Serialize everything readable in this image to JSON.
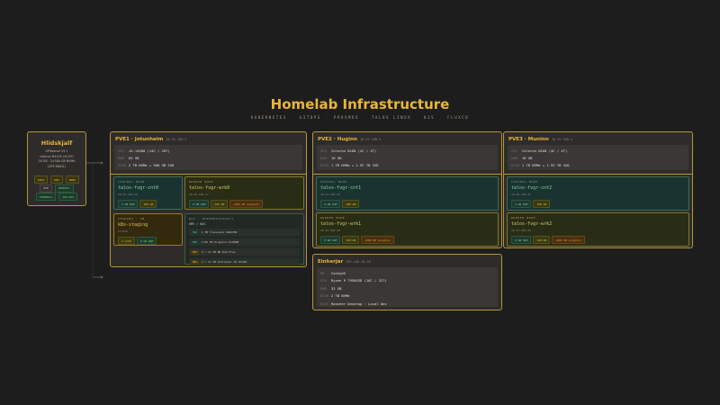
{
  "title": "Homelab Infrastructure",
  "subtitle": [
    "KUBERNETES",
    "GITOPS",
    "PROXMOX",
    "TALOS LINUX",
    "K3S",
    "FLUXCD"
  ],
  "colors": {
    "accent": "#e8b53a",
    "background": "#1e1d1d",
    "control": "#1b3330",
    "worker": "#2a2d16",
    "ram": "#7ccf99",
    "disk": "#cdc04a",
    "longhorn": "#e59a3a"
  },
  "router": {
    "name": "Hlidskjalf",
    "lines": [
      "OPNsense 25.1",
      "Celeron N5105 (4C/4T)",
      "16 GB  ·  2×500 GB NVMe",
      "(ZFS RAID1)"
    ],
    "services": [
      [
        {
          "label": "DHCP",
          "style": "olive"
        },
        {
          "label": "DNS",
          "style": "olive"
        },
        {
          "label": "DDNS",
          "style": "olive"
        }
      ],
      [
        {
          "label": "NTP",
          "style": "gray"
        },
        {
          "label": "HAPROXY",
          "style": "green"
        }
      ],
      [
        {
          "label": "FIREWALL",
          "style": "green"
        },
        {
          "label": "IDS/IPS",
          "style": "green"
        }
      ]
    ]
  },
  "hosts": [
    {
      "name": "PVE1 · Jotunheim",
      "ip": "10.32.100.2",
      "specs": [
        {
          "k": "CPU",
          "v": "i5-14500  (14C / 20T)"
        },
        {
          "k": "RAM",
          "v": "64 GB"
        },
        {
          "k": "DISK",
          "v": "2 TB NVMe  +  960 GB SSD"
        }
      ],
      "nodes": [
        {
          "role": "Control Node",
          "name": "talos-fvgr-cnt0",
          "ip": "10.32.100.32",
          "tags": [
            {
              "label": "4 GB RAM",
              "style": "ram"
            },
            {
              "label": "100 GB",
              "style": "disk"
            }
          ]
        },
        {
          "role": "Worker Node",
          "name": "talos-fvgr-wrk0",
          "ip": "10.32.100.37",
          "tags": [
            {
              "label": "8 GB RAM",
              "style": "ram"
            },
            {
              "label": "100 GB",
              "style": "disk"
            },
            {
              "label": "+600 GB Longhorn",
              "style": "lh"
            }
          ]
        },
        {
          "role": "Staging · VM",
          "name": "k8s-staging",
          "ip": "FluxCD",
          "tags": [
            {
              "label": "4 vCPU",
              "style": "disk"
            },
            {
              "label": "8 GB RAM",
              "style": "ram"
            }
          ]
        }
      ],
      "nas": {
        "role": "NAS · OpenMediaVault",
        "name": "OMV / NAS",
        "disks": [
          {
            "type": "SSD",
            "label": "1 TB Transcend SSD470K"
          },
          {
            "type": "SSD",
            "label": "3.84 TB Kingston DC600M"
          },
          {
            "type": "HDD",
            "label": "2 × 12 TB WD Red Plus"
          },
          {
            "type": "HDD",
            "label": "2 × 12 TB Ultrastar DC HC520"
          }
        ]
      }
    },
    {
      "name": "PVE2 · Huginn",
      "ip": "10.32.100.3",
      "specs": [
        {
          "k": "CPU",
          "v": "Celeron N100  (4C / 4T)"
        },
        {
          "k": "RAM",
          "v": "16 GB"
        },
        {
          "k": "DISK",
          "v": "1 TB NVMe  +  1.92 TB SSD"
        }
      ],
      "nodes": [
        {
          "role": "Control Node",
          "name": "talos-fvgr-cnt1",
          "ip": "10.32.100.33",
          "tags": [
            {
              "label": "4 GB RAM",
              "style": "ram"
            },
            {
              "label": "100 GB",
              "style": "disk"
            }
          ]
        },
        {
          "role": "Worker Node",
          "name": "talos-fvgr-wrk1",
          "ip": "10.32.100.38",
          "tags": [
            {
              "label": "8 GB RAM",
              "style": "ram"
            },
            {
              "label": "100 GB",
              "style": "disk"
            },
            {
              "label": "+600 GB Longhorn",
              "style": "lh"
            }
          ]
        }
      ]
    },
    {
      "name": "PVE3 · Muninn",
      "ip": "10.32.100.4",
      "specs": [
        {
          "k": "CPU",
          "v": "Celeron N100  (4C / 4T)"
        },
        {
          "k": "RAM",
          "v": "16 GB"
        },
        {
          "k": "DISK",
          "v": "1 TB NVMe  +  1.92 TB SSD"
        }
      ],
      "nodes": [
        {
          "role": "Control Node",
          "name": "talos-fvgr-cnt2",
          "ip": "10.32.100.31",
          "tags": [
            {
              "label": "4 GB RAM",
              "style": "ram"
            },
            {
              "label": "100 GB",
              "style": "disk"
            }
          ]
        },
        {
          "role": "Worker Node",
          "name": "talos-fvgr-wrk2",
          "ip": "10.32.100.36",
          "tags": [
            {
              "label": "8 GB RAM",
              "style": "ram"
            },
            {
              "label": "100 GB",
              "style": "disk"
            },
            {
              "label": "+600 GB Longhorn",
              "style": "lh"
            }
          ]
        }
      ]
    }
  ],
  "workstation": {
    "name": "Einherjar",
    "ip": "192.168.10.10",
    "specs": [
      {
        "k": "OS",
        "v": "CachyOS"
      },
      {
        "k": "CPU",
        "v": "Ryzen 9 7950X3D  (16C / 32T)"
      },
      {
        "k": "RAM",
        "v": "32 GB"
      },
      {
        "k": "DISK",
        "v": "2 TB NVMe"
      },
      {
        "k": "ROLE",
        "v": "Rancher Desktop  ·  Local Dev"
      }
    ]
  }
}
